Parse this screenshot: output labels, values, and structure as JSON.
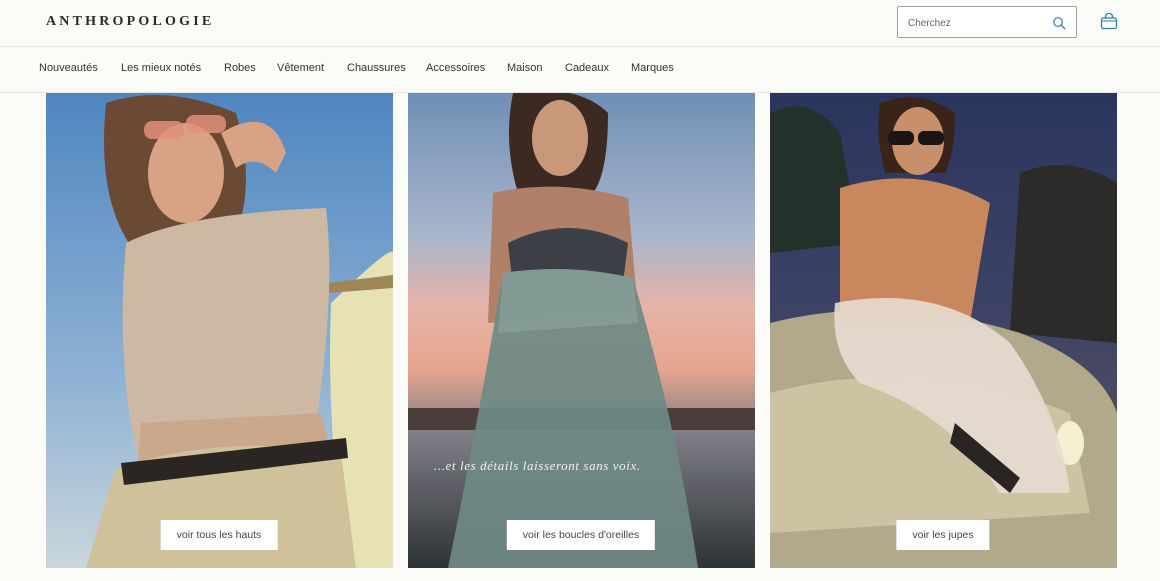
{
  "header": {
    "logo": "ANTHROPOLOGIE",
    "search_placeholder": "Cherchez",
    "search_icon": "search-icon",
    "bag_icon": "shopping-bag-icon"
  },
  "nav": {
    "items": [
      {
        "label": "Nouveautés"
      },
      {
        "label": "Les mieux notés"
      },
      {
        "label": "Robes"
      },
      {
        "label": "Vêtement"
      },
      {
        "label": "Chaussures"
      },
      {
        "label": "Accessoires"
      },
      {
        "label": "Maison"
      },
      {
        "label": "Cadeaux"
      },
      {
        "label": "Marques"
      }
    ]
  },
  "panels": [
    {
      "cta": "voir tous les hauts"
    },
    {
      "caption": "...et les détails laisseront sans voix.",
      "cta": "voir les boucles d'oreilles"
    },
    {
      "cta": "voir les jupes"
    }
  ],
  "colors": {
    "accent": "#2f7fa8",
    "background": "#fbfbf8",
    "border": "#e6e6e1"
  }
}
